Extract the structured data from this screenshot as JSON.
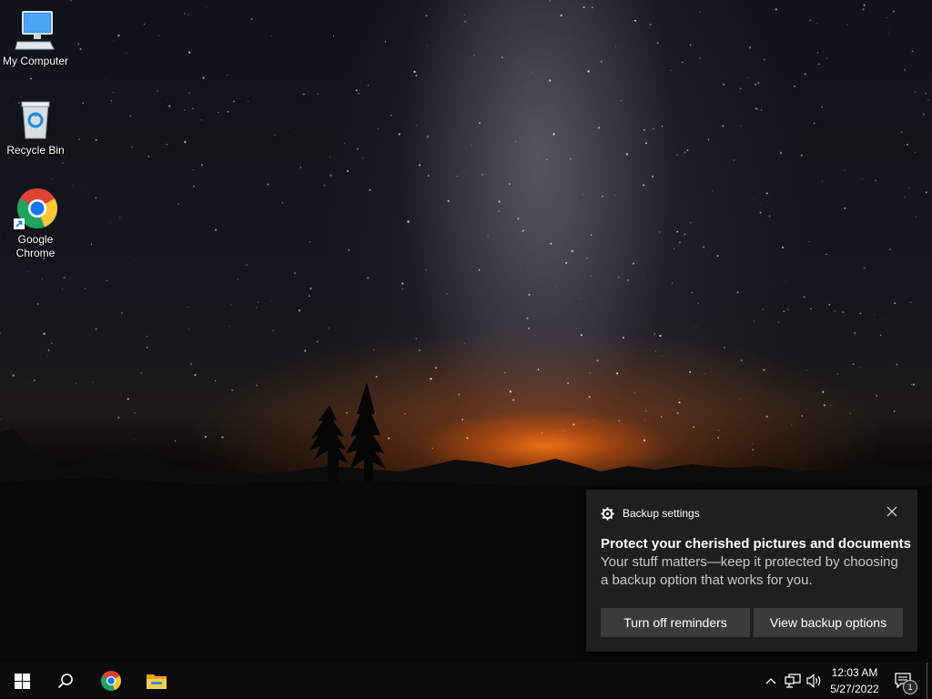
{
  "desktop": {
    "icons": [
      {
        "label": "My Computer",
        "icon": "monitor-icon"
      },
      {
        "label": "Recycle Bin",
        "icon": "recycle-bin-icon"
      },
      {
        "label_line1": "Google",
        "label_line2": "Chrome",
        "icon": "chrome-icon"
      }
    ]
  },
  "toast": {
    "app_name": "Backup settings",
    "title": "Protect your cherished pictures and documents",
    "body": "Your stuff matters—keep it protected by choosing a backup option that works for you.",
    "buttons": {
      "turn_off": "Turn off reminders",
      "view_options": "View backup options"
    }
  },
  "taskbar": {
    "time": "12:03 AM",
    "date": "5/27/2022",
    "notification_count": "1"
  },
  "colors": {
    "taskbar": "#0b0b0b",
    "toast_bg": "#1f1f1f",
    "toast_button": "#3b3b3b",
    "windows_blue": "#0078d7"
  }
}
